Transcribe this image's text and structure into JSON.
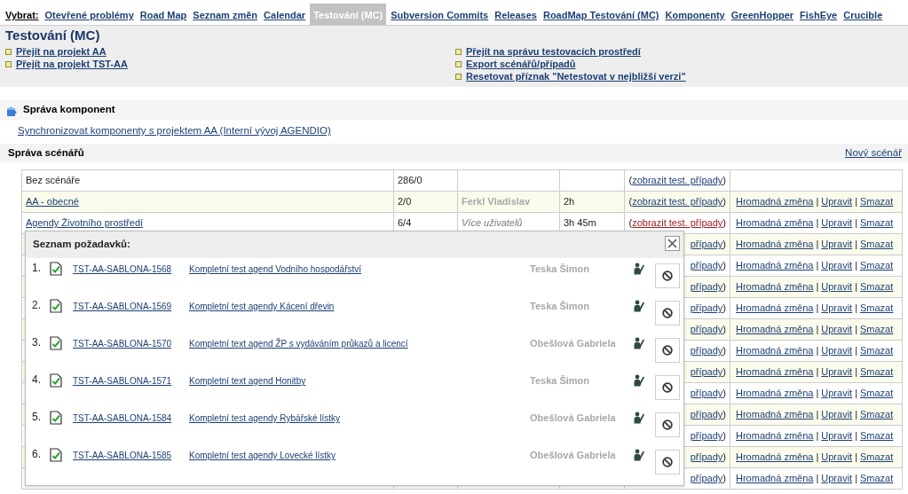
{
  "nav": {
    "label": "Vybrat:",
    "items": [
      {
        "label": "Otevřené problémy",
        "selected": false
      },
      {
        "label": "Road Map",
        "selected": false
      },
      {
        "label": "Seznam změn",
        "selected": false
      },
      {
        "label": "Calendar",
        "selected": false
      },
      {
        "label": "Testování (MC)",
        "selected": true
      },
      {
        "label": "Subversion Commits",
        "selected": false
      },
      {
        "label": "Releases",
        "selected": false
      },
      {
        "label": "RoadMap Testování (MC)",
        "selected": false
      },
      {
        "label": "Komponenty",
        "selected": false
      },
      {
        "label": "GreenHopper",
        "selected": false
      },
      {
        "label": "FishEye",
        "selected": false
      },
      {
        "label": "Crucible",
        "selected": false
      }
    ]
  },
  "header": {
    "title": "Testování (MC)",
    "links_left": [
      "Přejít na projekt AA",
      "Přejít na projekt TST-AA"
    ],
    "links_right": [
      "Přejít na správu testovacích prostředí",
      "Export scénářů/případů",
      "Resetovat příznak \"Netestovat v nejbližší verzi\""
    ]
  },
  "components": {
    "title": "Správa komponent",
    "link": "Synchronizovat komponenty s projektem AA (Interní vývoj AGENDIO)"
  },
  "scenarios": {
    "title": "Správa scénářů",
    "new_link": "Nový scénář",
    "rows": [
      {
        "kind": "default",
        "name": "Bez scénáře",
        "count": "286/0",
        "hovered": false,
        "test_cases": [
          {
            "kind": "text",
            "text": "("
          },
          {
            "kind": "link",
            "text": "zobrazit test. případy"
          },
          {
            "kind": "text",
            "text": ")"
          }
        ]
      },
      {
        "kind": "scenario",
        "name": "AA - obecné",
        "count": "2/0",
        "owner": {
          "text": "Ferkl Vladislav",
          "multiple": false
        },
        "time": "2h",
        "hovered": false,
        "test_cases": [
          {
            "kind": "text",
            "text": "("
          },
          {
            "kind": "link",
            "text": "zobrazit test. případy"
          },
          {
            "kind": "text",
            "text": ")"
          }
        ],
        "actions": [
          {
            "kind": "link",
            "text": "Hromadná změna"
          },
          {
            "kind": "sep",
            "text": "|"
          },
          {
            "kind": "link",
            "text": "Upravit"
          },
          {
            "kind": "sep",
            "text": "|"
          },
          {
            "kind": "link",
            "text": "Smazat"
          }
        ]
      },
      {
        "kind": "scenario",
        "name": "Agendy Životního prostředí",
        "count": "6/4",
        "owner": {
          "text": "Více uživatelů",
          "multiple": true
        },
        "time": "3h 45m",
        "hovered": true,
        "test_cases": [
          {
            "kind": "text",
            "text": "("
          },
          {
            "kind": "link",
            "text": "zobrazit test. případy"
          },
          {
            "kind": "text",
            "text": ")"
          }
        ],
        "actions": [
          {
            "kind": "link",
            "text": "Hromadná změna"
          },
          {
            "kind": "sep",
            "text": "|"
          },
          {
            "kind": "link",
            "text": "Upravit"
          },
          {
            "kind": "sep",
            "text": "|"
          },
          {
            "kind": "link",
            "text": "Smazat"
          }
        ]
      },
      {
        "kind": "scenario",
        "hovered": false,
        "test_cases": [
          {
            "kind": "link",
            "text": "případy"
          },
          {
            "kind": "text",
            "text": ")"
          }
        ],
        "actions": [
          {
            "kind": "link",
            "text": "Hromadná změna"
          },
          {
            "kind": "sep",
            "text": "|"
          },
          {
            "kind": "link",
            "text": "Upravit"
          },
          {
            "kind": "sep",
            "text": "|"
          },
          {
            "kind": "link",
            "text": "Smazat"
          }
        ]
      },
      {
        "kind": "scenario",
        "hovered": false,
        "test_cases": [
          {
            "kind": "link",
            "text": "případy"
          },
          {
            "kind": "text",
            "text": ")"
          }
        ],
        "actions": [
          {
            "kind": "link",
            "text": "Hromadná změna"
          },
          {
            "kind": "sep",
            "text": "|"
          },
          {
            "kind": "link",
            "text": "Upravit"
          },
          {
            "kind": "sep",
            "text": "|"
          },
          {
            "kind": "link",
            "text": "Smazat"
          }
        ]
      },
      {
        "kind": "scenario",
        "hovered": false,
        "test_cases": [
          {
            "kind": "link",
            "text": "případy"
          },
          {
            "kind": "text",
            "text": ")"
          }
        ],
        "actions": [
          {
            "kind": "link",
            "text": "Hromadná změna"
          },
          {
            "kind": "sep",
            "text": "|"
          },
          {
            "kind": "link",
            "text": "Upravit"
          },
          {
            "kind": "sep",
            "text": "|"
          },
          {
            "kind": "link",
            "text": "Smazat"
          }
        ]
      },
      {
        "kind": "scenario",
        "hovered": false,
        "test_cases": [
          {
            "kind": "link",
            "text": "případy"
          },
          {
            "kind": "text",
            "text": ")"
          }
        ],
        "actions": [
          {
            "kind": "link",
            "text": "Hromadná změna"
          },
          {
            "kind": "sep",
            "text": "|"
          },
          {
            "kind": "link",
            "text": "Upravit"
          },
          {
            "kind": "sep",
            "text": "|"
          },
          {
            "kind": "link",
            "text": "Smazat"
          }
        ]
      },
      {
        "kind": "scenario",
        "hovered": false,
        "test_cases": [
          {
            "kind": "link",
            "text": "případy"
          },
          {
            "kind": "text",
            "text": ")"
          }
        ],
        "actions": [
          {
            "kind": "link",
            "text": "Hromadná změna"
          },
          {
            "kind": "sep",
            "text": "|"
          },
          {
            "kind": "link",
            "text": "Upravit"
          },
          {
            "kind": "sep",
            "text": "|"
          },
          {
            "kind": "link",
            "text": "Smazat"
          }
        ]
      },
      {
        "kind": "scenario",
        "hovered": false,
        "test_cases": [
          {
            "kind": "link",
            "text": "případy"
          },
          {
            "kind": "text",
            "text": ")"
          }
        ],
        "actions": [
          {
            "kind": "link",
            "text": "Hromadná změna"
          },
          {
            "kind": "sep",
            "text": "|"
          },
          {
            "kind": "link",
            "text": "Upravit"
          },
          {
            "kind": "sep",
            "text": "|"
          },
          {
            "kind": "link",
            "text": "Smazat"
          }
        ]
      },
      {
        "kind": "scenario",
        "hovered": false,
        "test_cases": [
          {
            "kind": "link",
            "text": "případy"
          },
          {
            "kind": "text",
            "text": ")"
          }
        ],
        "actions": [
          {
            "kind": "link",
            "text": "Hromadná změna"
          },
          {
            "kind": "sep",
            "text": "|"
          },
          {
            "kind": "link",
            "text": "Upravit"
          },
          {
            "kind": "sep",
            "text": "|"
          },
          {
            "kind": "link",
            "text": "Smazat"
          }
        ]
      },
      {
        "kind": "scenario",
        "hovered": false,
        "test_cases": [
          {
            "kind": "link",
            "text": "případy"
          },
          {
            "kind": "text",
            "text": ")"
          }
        ],
        "actions": [
          {
            "kind": "link",
            "text": "Hromadná změna"
          },
          {
            "kind": "sep",
            "text": "|"
          },
          {
            "kind": "link",
            "text": "Upravit"
          },
          {
            "kind": "sep",
            "text": "|"
          },
          {
            "kind": "link",
            "text": "Smazat"
          }
        ]
      },
      {
        "kind": "scenario",
        "hovered": false,
        "test_cases": [
          {
            "kind": "link",
            "text": "případy"
          },
          {
            "kind": "text",
            "text": ")"
          }
        ],
        "actions": [
          {
            "kind": "link",
            "text": "Hromadná změna"
          },
          {
            "kind": "sep",
            "text": "|"
          },
          {
            "kind": "link",
            "text": "Upravit"
          },
          {
            "kind": "sep",
            "text": "|"
          },
          {
            "kind": "link",
            "text": "Smazat"
          }
        ]
      },
      {
        "kind": "scenario",
        "hovered": false,
        "test_cases": [
          {
            "kind": "link",
            "text": "případy"
          },
          {
            "kind": "text",
            "text": ")"
          }
        ],
        "actions": [
          {
            "kind": "link",
            "text": "Hromadná změna"
          },
          {
            "kind": "sep",
            "text": "|"
          },
          {
            "kind": "link",
            "text": "Upravit"
          },
          {
            "kind": "sep",
            "text": "|"
          },
          {
            "kind": "link",
            "text": "Smazat"
          }
        ]
      },
      {
        "kind": "scenario",
        "hovered": false,
        "test_cases": [
          {
            "kind": "link",
            "text": "případy"
          },
          {
            "kind": "text",
            "text": ")"
          }
        ],
        "actions": [
          {
            "kind": "link",
            "text": "Hromadná změna"
          },
          {
            "kind": "sep",
            "text": "|"
          },
          {
            "kind": "link",
            "text": "Upravit"
          },
          {
            "kind": "sep",
            "text": "|"
          },
          {
            "kind": "link",
            "text": "Smazat"
          }
        ]
      },
      {
        "kind": "scenario",
        "hovered": false,
        "test_cases": [
          {
            "kind": "link",
            "text": "případy"
          },
          {
            "kind": "text",
            "text": ")"
          }
        ],
        "actions": [
          {
            "kind": "link",
            "text": "Hromadná změna"
          },
          {
            "kind": "sep",
            "text": "|"
          },
          {
            "kind": "link",
            "text": "Upravit"
          },
          {
            "kind": "sep",
            "text": "|"
          },
          {
            "kind": "link",
            "text": "Smazat"
          }
        ]
      }
    ]
  },
  "popup": {
    "title": "Seznam požadavků:",
    "items": [
      {
        "number": "1.",
        "id": "TST-AA-SABLONA-1568",
        "title": "Kompletní test agend Vodního hospodářství",
        "person": "Teska Šimon"
      },
      {
        "number": "2.",
        "id": "TST-AA-SABLONA-1569",
        "title": "Kompletní test agendy Kácení dřevin",
        "person": "Teska Šimon"
      },
      {
        "number": "3.",
        "id": "TST-AA-SABLONA-1570",
        "title": "Kompletní text agend ŽP s vydáváním průkazů a licencí",
        "person": "Obešlová Gabriela"
      },
      {
        "number": "4.",
        "id": "TST-AA-SABLONA-1571",
        "title": "Kompletní text agend Honitby",
        "person": "Teska Šimon"
      },
      {
        "number": "5.",
        "id": "TST-AA-SABLONA-1584",
        "title": "Kompletní test agendy Rybářské lístky",
        "person": "Obešlová Gabriela"
      },
      {
        "number": "6.",
        "id": "TST-AA-SABLONA-1585",
        "title": "Kompletní test agendy Lovecké lístky",
        "person": "Obešlová Gabriela"
      }
    ]
  }
}
